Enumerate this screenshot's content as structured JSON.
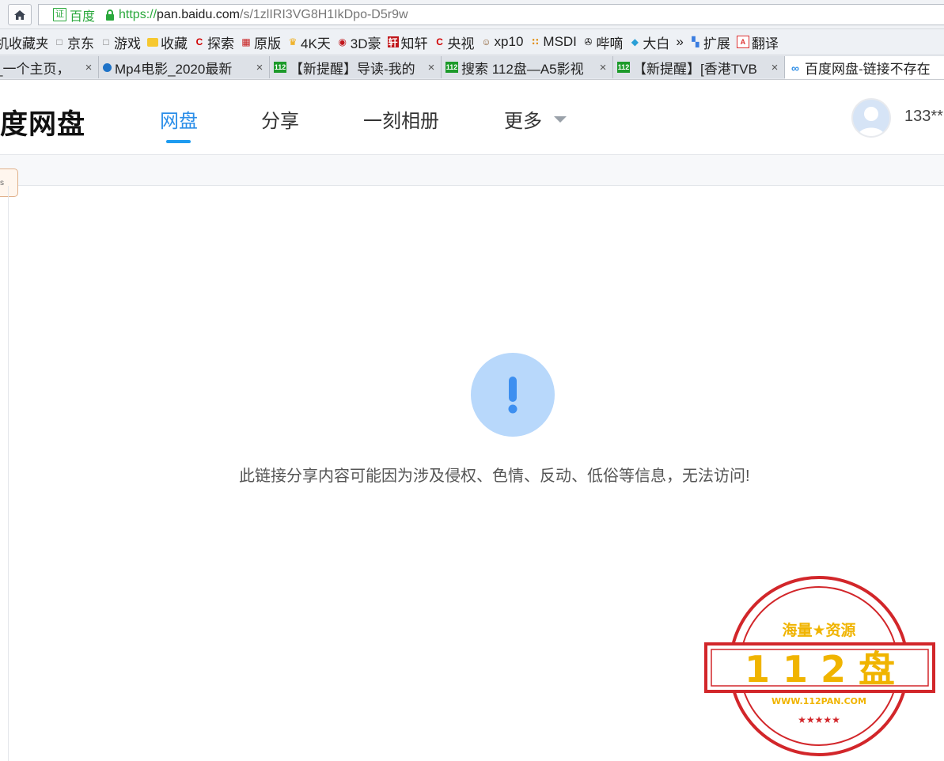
{
  "browser": {
    "address": {
      "cert_label": "证",
      "cert_name": "百度",
      "url_proto": "https://",
      "url_host": "pan.baidu.com",
      "url_path": "/s/1zlIRI3VG8H1IkDpo-D5r9w"
    },
    "bookmarks": [
      {
        "label": "机收藏夹",
        "icon": "none"
      },
      {
        "label": "京东",
        "icon": "page-icon"
      },
      {
        "label": "游戏",
        "icon": "page-icon"
      },
      {
        "label": "收藏",
        "icon": "folder-icon"
      },
      {
        "label": "探索",
        "icon": "c-logo-icon"
      },
      {
        "label": "原版",
        "icon": "grid-logo-icon"
      },
      {
        "label": "4K天",
        "icon": "cup-icon"
      },
      {
        "label": "3D豪",
        "icon": "3d-logo-icon"
      },
      {
        "label": "知轩",
        "icon": "zx-logo-icon"
      },
      {
        "label": "央视",
        "icon": "c-logo-icon"
      },
      {
        "label": "xp10",
        "icon": "person-icon"
      },
      {
        "label": "MSDI",
        "icon": "msdn-icon"
      },
      {
        "label": "哔嘀",
        "icon": "film-reel-icon"
      },
      {
        "label": "大白",
        "icon": "diamond-icon"
      },
      {
        "label": "»",
        "icon": "none"
      },
      {
        "label": "扩展",
        "icon": "apps-icon"
      },
      {
        "label": "翻译",
        "icon": "translate-icon"
      }
    ],
    "tabs": [
      {
        "label": "_一个主页，",
        "icon": "none",
        "active": false
      },
      {
        "label": "Mp4电影_2020最新",
        "icon": "globe-icon",
        "active": false
      },
      {
        "label": "【新提醒】导读-我的",
        "icon": "site-112-icon",
        "active": false
      },
      {
        "label": "搜索 112盘—A5影视",
        "icon": "site-112-icon",
        "active": false
      },
      {
        "label": "【新提醒】[香港TVB",
        "icon": "site-112-icon",
        "active": false
      },
      {
        "label": "百度网盘-链接不存在",
        "icon": "baidu-pan-icon",
        "active": true
      }
    ],
    "tab_close_glyph": "×",
    "site_icon_text": "112"
  },
  "site": {
    "logo_text": "度网盘",
    "nav": {
      "wangpan": "网盘",
      "share": "分享",
      "moment": "一刻相册",
      "more": "更多"
    },
    "username": "133**",
    "side_tag": "s"
  },
  "error": {
    "glyph": "!",
    "message": "此链接分享内容可能因为涉及侵权、色情、反动、低俗等信息，无法访问!"
  },
  "watermark": {
    "top_text": "海量★资源",
    "main_text": "1 1 2 盘",
    "url_text": "WWW.112PAN.COM",
    "bottom_stars": "★★★★★",
    "colors": {
      "ring": "#d2262a",
      "text": "#f0b400"
    }
  },
  "colors": {
    "accent": "#2b8ee8",
    "underline": "#1e9bf0",
    "warn_circle": "#b8d8fb",
    "warn_glyph": "#3d8ff0",
    "secure_green": "#2aa83c"
  }
}
